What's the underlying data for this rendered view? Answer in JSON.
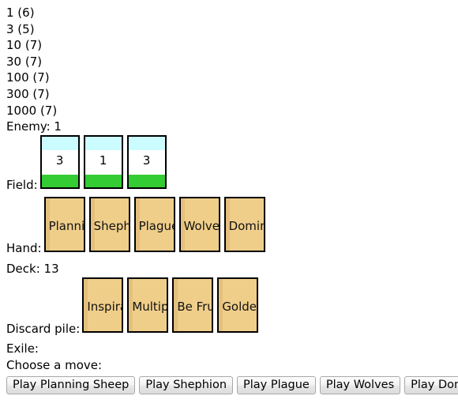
{
  "sheep_counts": [
    "1 (6)",
    "3 (5)",
    "10 (7)",
    "30 (7)",
    "100 (7)",
    "300 (7)",
    "1000 (7)"
  ],
  "enemy": {
    "label": "Enemy: 1"
  },
  "field": {
    "label": "Field:",
    "cards": [
      {
        "value": "3"
      },
      {
        "value": "1"
      },
      {
        "value": "3"
      }
    ]
  },
  "hand": {
    "label": "Hand:",
    "cards": [
      {
        "name": "Planning Sheep"
      },
      {
        "name": "Shephion"
      },
      {
        "name": "Plague"
      },
      {
        "name": "Wolves"
      },
      {
        "name": "Dominion"
      }
    ]
  },
  "deck": {
    "label": "Deck: 13"
  },
  "discard": {
    "label": "Discard pile:",
    "cards": [
      {
        "name": "Inspiration"
      },
      {
        "name": "Multiply"
      },
      {
        "name": "Be Fruitful"
      },
      {
        "name": "Golden Hooves"
      }
    ]
  },
  "exile": {
    "label": "Exile:"
  },
  "choose": {
    "label": "Choose a move:"
  },
  "moves": [
    {
      "label": "Play Planning Sheep"
    },
    {
      "label": "Play Shephion"
    },
    {
      "label": "Play Plague"
    },
    {
      "label": "Play Wolves"
    },
    {
      "label": "Play Dominion"
    }
  ],
  "colors": {
    "sheep_top": "#cbfcff",
    "sheep_bottom": "#33cc33",
    "card_tan": "#efce8a",
    "border": "#000000"
  }
}
